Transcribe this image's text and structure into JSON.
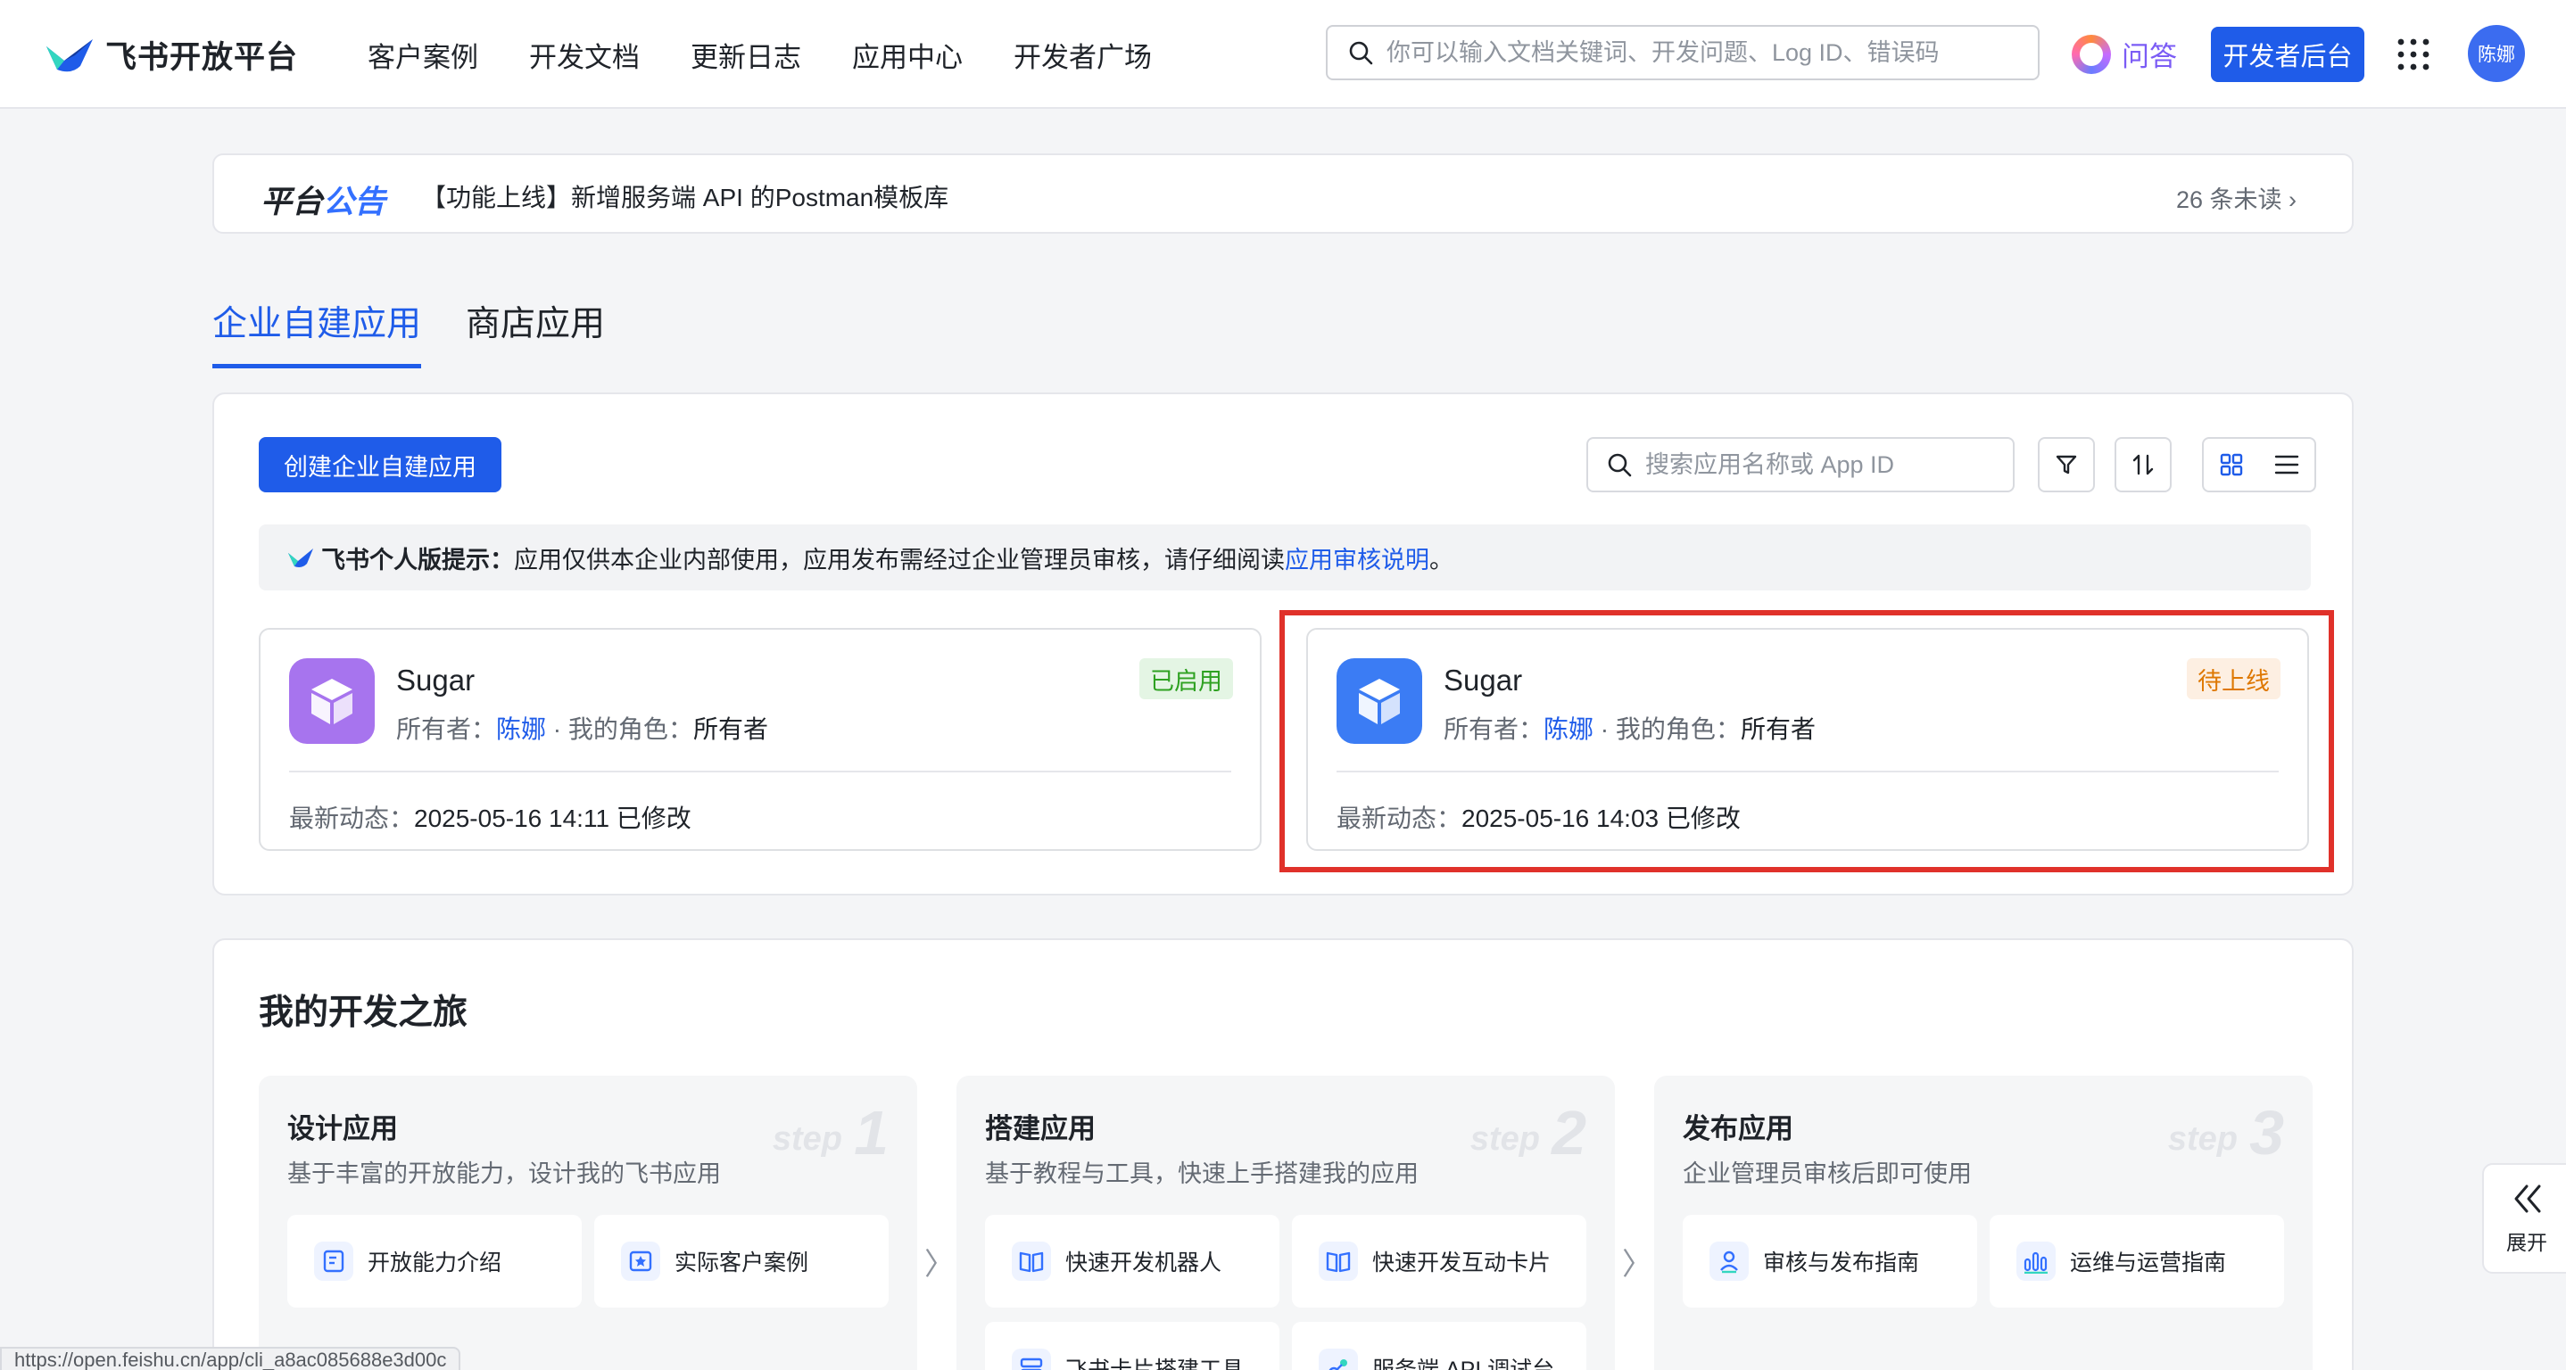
{
  "header": {
    "logo_text": "飞书开放平台",
    "nav": [
      "客户案例",
      "开发文档",
      "更新日志",
      "应用中心",
      "开发者广场"
    ],
    "search_placeholder": "你可以输入文档关键词、开发问题、Log ID、错误码",
    "ask_label": "问答",
    "dev_console_label": "开发者后台",
    "avatar_text": "陈娜"
  },
  "announcement": {
    "title_part1": "平台",
    "title_part2": "公告",
    "text": "【功能上线】新增服务端 API 的Postman模板库",
    "unread": "26 条未读"
  },
  "tabs": [
    "企业自建应用",
    "商店应用"
  ],
  "apps_panel": {
    "create_label": "创建企业自建应用",
    "search_placeholder": "搜索应用名称或 App ID",
    "tip_title": "飞书个人版提示：",
    "tip_text": "应用仅供本企业内部使用，应用发布需经过企业管理员审核，请仔细阅读 ",
    "tip_link": "应用审核说明",
    "tip_end": "。",
    "cards": [
      {
        "name": "Sugar",
        "owner_label": "所有者：",
        "owner": "陈娜",
        "sep": " · ",
        "role_label": "我的角色：",
        "role": "所有者",
        "status": "已启用",
        "activity_label": "最新动态：",
        "activity": "2025-05-16 14:11 已修改",
        "icon_color": "#a774ee",
        "badge_bg": "#e4f5e4",
        "badge_fg": "#2ea121"
      },
      {
        "name": "Sugar",
        "owner_label": "所有者：",
        "owner": "陈娜",
        "sep": " · ",
        "role_label": "我的角色：",
        "role": "所有者",
        "status": "待上线",
        "activity_label": "最新动态：",
        "activity": "2025-05-16 14:03 已修改",
        "icon_color": "#3b7cf4",
        "badge_bg": "#fdefe2",
        "badge_fg": "#de7802"
      }
    ]
  },
  "journey": {
    "title": "我的开发之旅",
    "steps": [
      {
        "title": "设计应用",
        "desc": "基于丰富的开放能力，设计我的飞书应用",
        "step_word": "step",
        "step_num": "1",
        "links": [
          "开放能力介绍",
          "实际客户案例"
        ]
      },
      {
        "title": "搭建应用",
        "desc": "基于教程与工具，快速上手搭建我的应用",
        "step_word": "step",
        "step_num": "2",
        "links": [
          "快速开发机器人",
          "快速开发互动卡片",
          "飞书卡片搭建工具",
          "服务端 API 调试台"
        ]
      },
      {
        "title": "发布应用",
        "desc": "企业管理员审核后即可使用",
        "step_word": "step",
        "step_num": "3",
        "links": [
          "审核与发布指南",
          "运维与运营指南"
        ]
      }
    ]
  },
  "expand_label": "展开",
  "status_url": "https://open.feishu.cn/app/cli_a8ac085688e3d00c"
}
